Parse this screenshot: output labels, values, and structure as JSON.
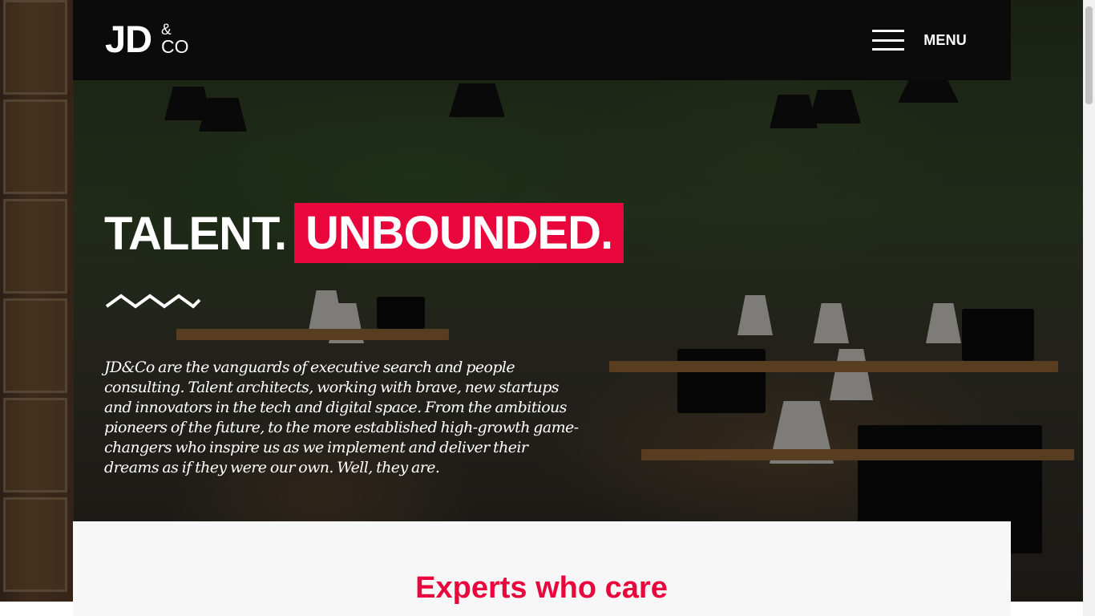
{
  "header": {
    "logo": {
      "main": "JD",
      "amp": "&",
      "co": "CO"
    },
    "menu_label": "MENU"
  },
  "hero": {
    "headline_plain": "TALENT.",
    "headline_highlight": "UNBOUNDED.",
    "intro": "JD&Co are the vanguards of executive search and people consulting. Talent architects, working with brave, new startups and innovators in the tech and digital space. From the ambitious pioneers of the future, to the more established high-growth game-changers who inspire us as we implement and deliver their dreams as if they were our own. Well, they are."
  },
  "section": {
    "title": "Experts who care"
  },
  "colors": {
    "accent": "#e8063c",
    "header_bg": "#0b0b0b",
    "panel_bg": "#f7f7f7"
  },
  "icons": [
    "hamburger-icon",
    "zigzag-icon"
  ]
}
